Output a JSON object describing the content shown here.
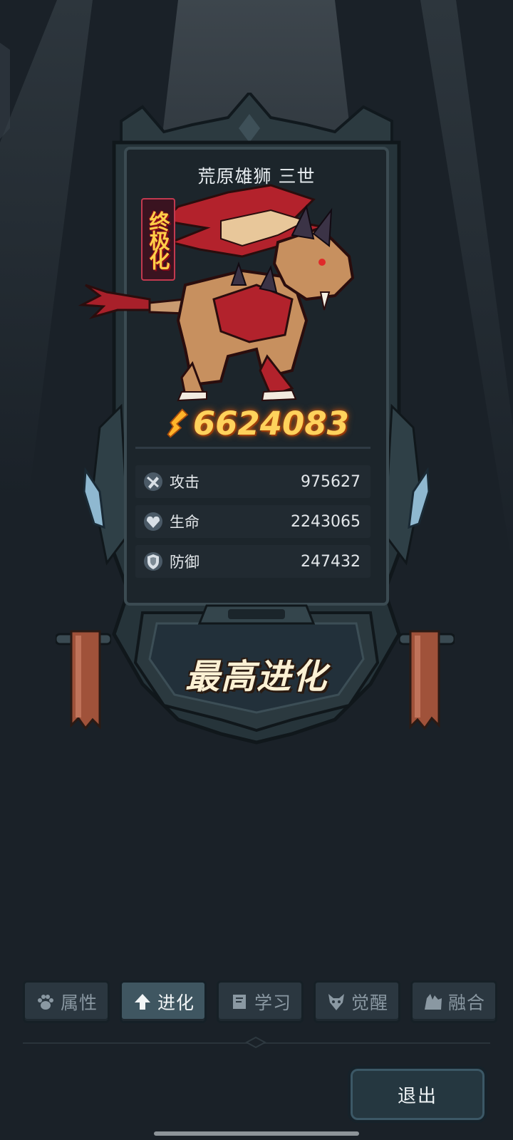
{
  "pet": {
    "name": "荒原雄狮 三世",
    "tier": "终极化",
    "power": "6624083"
  },
  "stats": [
    {
      "icon": "attack-icon",
      "label": "攻击",
      "value": "975627"
    },
    {
      "icon": "health-icon",
      "label": "生命",
      "value": "2243065"
    },
    {
      "icon": "defense-icon",
      "label": "防御",
      "value": "247432"
    }
  ],
  "evolution": {
    "status": "最高进化"
  },
  "tabs": [
    {
      "icon": "paw-icon",
      "label": "属性",
      "active": false
    },
    {
      "icon": "up-arrow-icon",
      "label": "进化",
      "active": true
    },
    {
      "icon": "book-icon",
      "label": "学习",
      "active": false
    },
    {
      "icon": "beast-head-icon",
      "label": "觉醒",
      "active": false
    },
    {
      "icon": "fusion-icon",
      "label": "融合",
      "active": false
    }
  ],
  "exit_button": {
    "label": "退出"
  },
  "colors": {
    "background": "#1a2128",
    "power_gold": "#ffd25c",
    "tier_red": "#c2394f",
    "tab_active": "#3f5661",
    "tab_inactive": "#2b3740"
  }
}
